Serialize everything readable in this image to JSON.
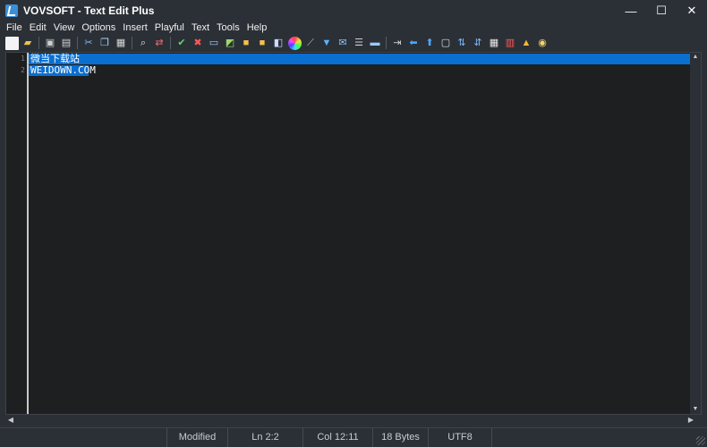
{
  "window": {
    "title": "VOVSOFT - Text Edit Plus",
    "controls": {
      "minimize": "—",
      "maximize": "☐",
      "close": "✕"
    }
  },
  "menu": [
    "File",
    "Edit",
    "View",
    "Options",
    "Insert",
    "Playful",
    "Text",
    "Tools",
    "Help"
  ],
  "toolbar_icons": [
    "new-file-icon",
    "open-folder-icon",
    "save-icon",
    "print-icon",
    "cut-icon",
    "copy-icon",
    "paste-icon",
    "find-icon",
    "replace-icon",
    "spell-check-icon",
    "delete-icon",
    "monitor-icon",
    "html-icon",
    "lock-icon",
    "unlock-icon",
    "font-icon",
    "color-wheel-icon",
    "eyedropper-icon",
    "filter-icon",
    "email-icon",
    "list-icon",
    "folder-icon",
    "indent-icon",
    "arrow-left-icon",
    "arrow-up-icon",
    "window-icon",
    "sort-az-icon",
    "sort-za-icon",
    "table-icon",
    "calendar-icon",
    "warning-icon",
    "lock-badge-icon"
  ],
  "editor": {
    "lines": [
      {
        "number": "1",
        "text": "微当下载站"
      },
      {
        "number": "2",
        "text": "WEIDOWN.COM"
      }
    ]
  },
  "status": {
    "modified": "Modified",
    "line": "Ln 2:2",
    "column": "Col 12:11",
    "size": "18 Bytes",
    "encoding": "UTF8"
  },
  "colors": {
    "background": "#2b3036",
    "editor_background": "#1e1f20",
    "selection": "#0a6fd0",
    "text": "#ffffff"
  }
}
